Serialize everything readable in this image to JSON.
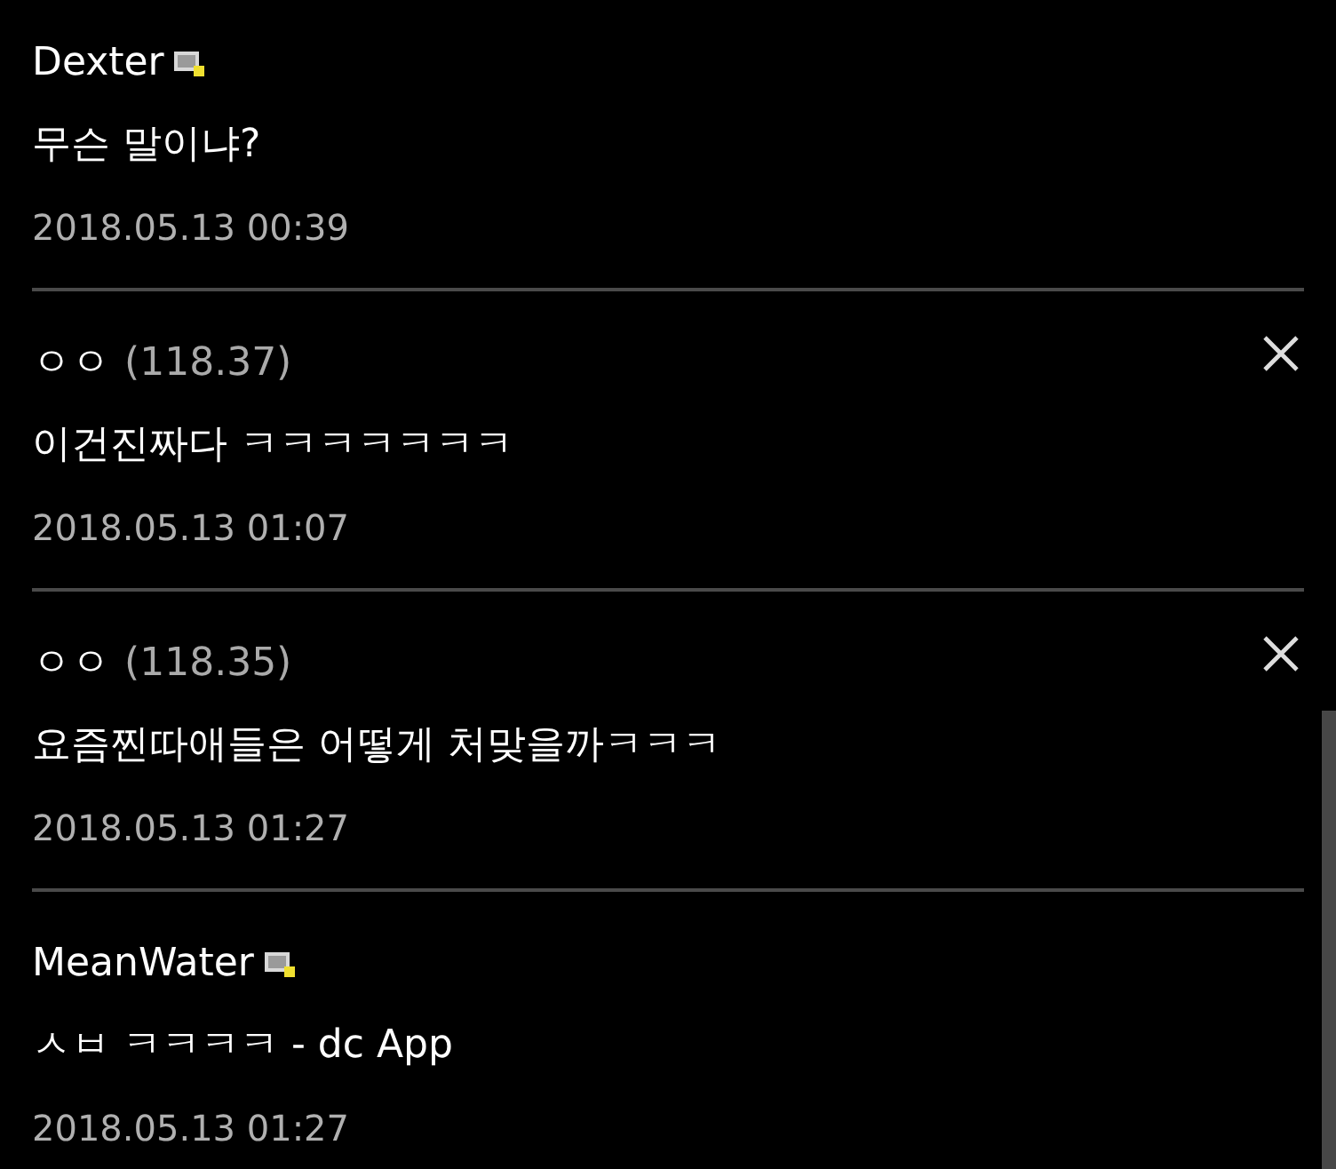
{
  "comments": [
    {
      "kind": "member",
      "name": "Dexter",
      "body": "무슨 말이냐?",
      "time": "2018.05.13 00:39",
      "deletable": false
    },
    {
      "kind": "guest",
      "name": "ㅇㅇ",
      "ip": "(118.37)",
      "body": "이건진짜다 ㅋㅋㅋㅋㅋㅋㅋ",
      "time": "2018.05.13 01:07",
      "deletable": true
    },
    {
      "kind": "guest",
      "name": "ㅇㅇ",
      "ip": "(118.35)",
      "body": "요즘찐따애들은 어떻게 처맞을까ㅋㅋㅋ",
      "time": "2018.05.13 01:27",
      "deletable": true
    },
    {
      "kind": "member",
      "name": "MeanWater",
      "body": "ㅅㅂ ㅋㅋㅋㅋ - dc App",
      "time": "2018.05.13 01:27",
      "deletable": false
    }
  ]
}
